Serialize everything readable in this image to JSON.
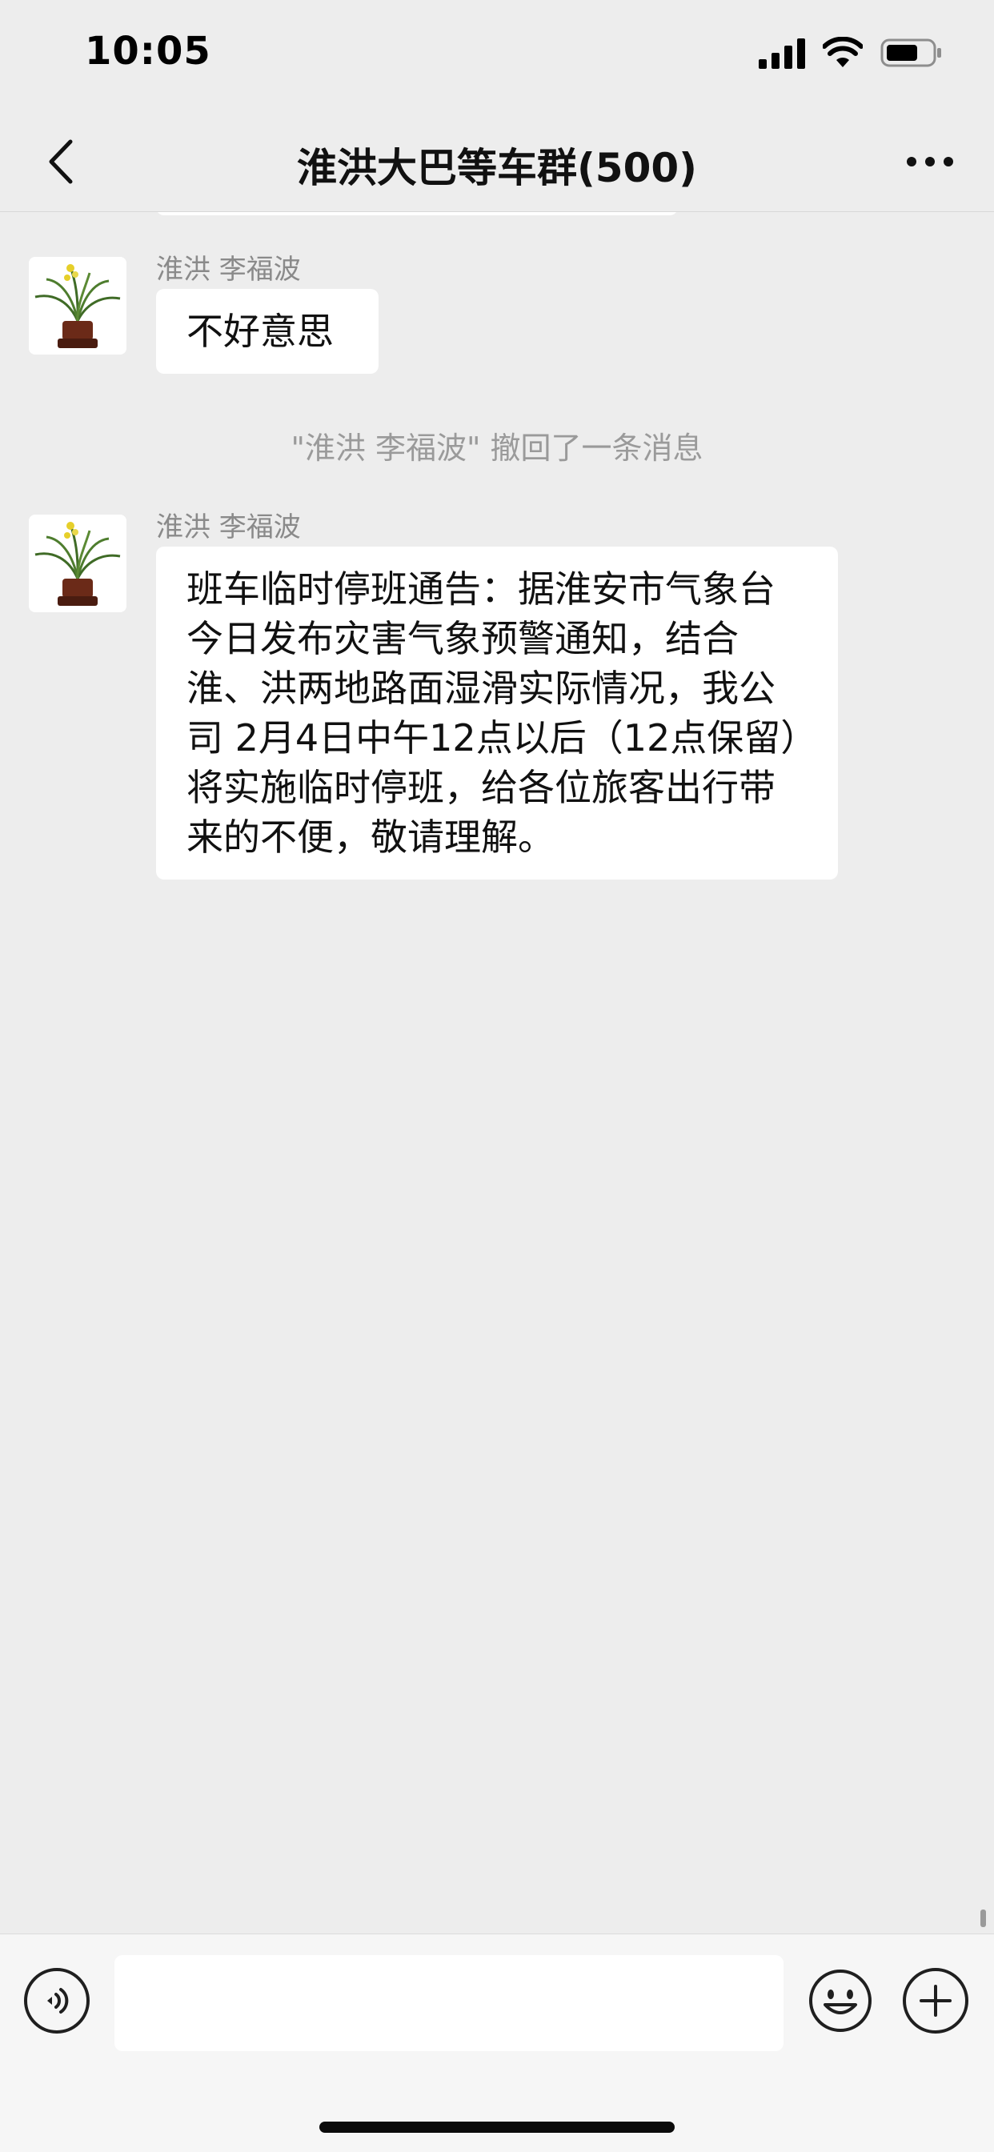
{
  "status_bar": {
    "time": "10:05",
    "icons": [
      "signal-icon",
      "wifi-icon",
      "battery-icon"
    ]
  },
  "nav": {
    "title": "淮洪大巴等车群(500)",
    "back_icon": "chevron-left-icon",
    "more_icon": "more-dots-icon"
  },
  "messages": [
    {
      "sender": "淮洪 李福波",
      "text": "不好意思",
      "avatar": "potted-plant-avatar"
    },
    {
      "sender": "淮洪 李福波",
      "text": "班车临时停班通告：据淮安市气象台今日发布灾害气象预警通知，结合淮、洪两地路面湿滑实际情况，我公司 2月4日中午12点以后（12点保留）将实施临时停班，给各位旅客出行带来的不便，敬请理解。",
      "avatar": "potted-plant-avatar"
    }
  ],
  "system_message": "\"淮洪 李福波\" 撤回了一条消息",
  "input_bar": {
    "value": "",
    "voice_icon": "voice-icon",
    "emoji_icon": "emoji-icon",
    "plus_icon": "plus-icon"
  },
  "colors": {
    "background": "#ededed",
    "bubble": "#ffffff",
    "secondary_text": "#8a8a8a"
  }
}
